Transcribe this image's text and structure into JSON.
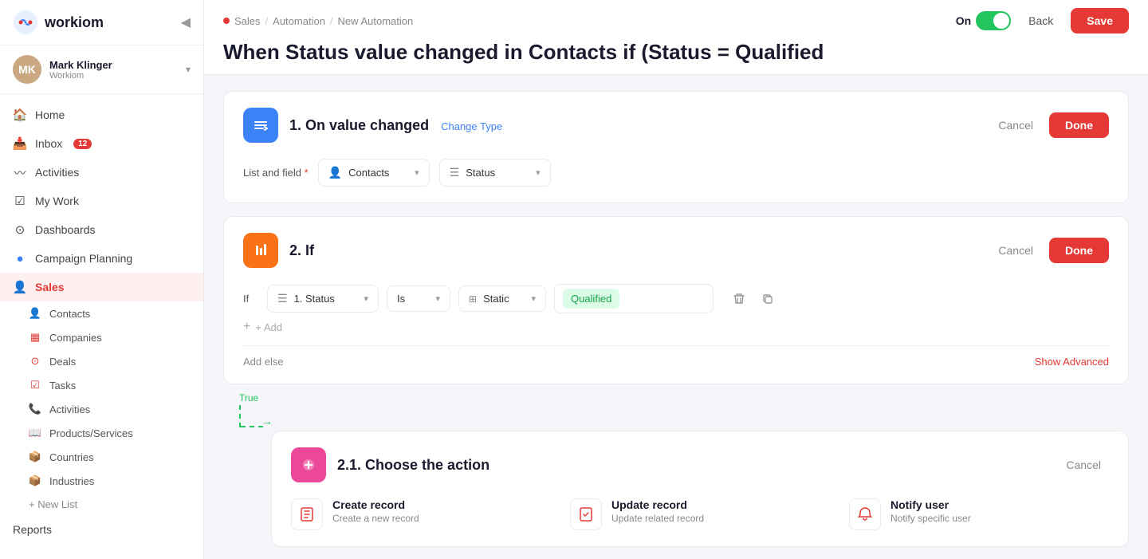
{
  "app": {
    "name": "workiom"
  },
  "user": {
    "name": "Mark Klinger",
    "company": "Workiom",
    "initials": "MK"
  },
  "sidebar": {
    "collapse_icon": "◀",
    "nav_items": [
      {
        "id": "home",
        "label": "Home",
        "icon": "🏠",
        "active": false
      },
      {
        "id": "inbox",
        "label": "Inbox",
        "icon": "📥",
        "badge": "12",
        "active": false
      },
      {
        "id": "activities",
        "label": "Activities",
        "icon": "〰",
        "active": false
      },
      {
        "id": "my-work",
        "label": "My Work",
        "icon": "☑",
        "active": false
      },
      {
        "id": "dashboards",
        "label": "Dashboards",
        "icon": "⊙",
        "active": false
      },
      {
        "id": "campaign-planning",
        "label": "Campaign Planning",
        "icon": "🔵",
        "active": false
      },
      {
        "id": "sales",
        "label": "Sales",
        "icon": "👤",
        "active": true
      }
    ],
    "sub_items": [
      {
        "id": "contacts",
        "label": "Contacts",
        "icon": "👤"
      },
      {
        "id": "companies",
        "label": "Companies",
        "icon": "▦"
      },
      {
        "id": "deals",
        "label": "Deals",
        "icon": "⊙"
      },
      {
        "id": "tasks",
        "label": "Tasks",
        "icon": "☑"
      },
      {
        "id": "activities",
        "label": "Activities",
        "icon": "📞"
      },
      {
        "id": "products",
        "label": "Products/Services",
        "icon": "📖"
      },
      {
        "id": "countries",
        "label": "Countries",
        "icon": "📦"
      },
      {
        "id": "industries",
        "label": "Industries",
        "icon": "📦"
      }
    ],
    "new_list_label": "+ New List",
    "reports_label": "Reports"
  },
  "breadcrumb": {
    "items": [
      "Sales",
      "Automation",
      "New Automation"
    ]
  },
  "page": {
    "title": "When Status value changed in Contacts if (Status = Qualified"
  },
  "topbar": {
    "toggle_label": "On",
    "toggle_on": true,
    "back_label": "Back",
    "save_label": "Save"
  },
  "step1": {
    "number": "1.",
    "title": "On value changed",
    "change_type_label": "Change Type",
    "field_label": "List and field",
    "field_required": true,
    "list_value": "Contacts",
    "field_value": "Status",
    "cancel_label": "Cancel",
    "done_label": "Done"
  },
  "step2": {
    "number": "2.",
    "title": "If",
    "cancel_label": "Cancel",
    "done_label": "Done",
    "if_label": "If",
    "condition_field": "1. Status",
    "condition_op": "Is",
    "condition_type": "Static",
    "condition_value": "Qualified",
    "add_label": "+ Add",
    "add_else_label": "Add else",
    "show_advanced_label": "Show Advanced",
    "true_label": "True"
  },
  "step21": {
    "number": "2.1.",
    "title": "Choose the action",
    "cancel_label": "Cancel",
    "actions": [
      {
        "id": "create-record",
        "title": "Create record",
        "description": "Create a new record",
        "icon": "📄"
      },
      {
        "id": "update-record",
        "title": "Update record",
        "description": "Update related record",
        "icon": "✏"
      },
      {
        "id": "notify-user",
        "title": "Notify user",
        "description": "Notify specific user",
        "icon": "🔔"
      }
    ]
  }
}
